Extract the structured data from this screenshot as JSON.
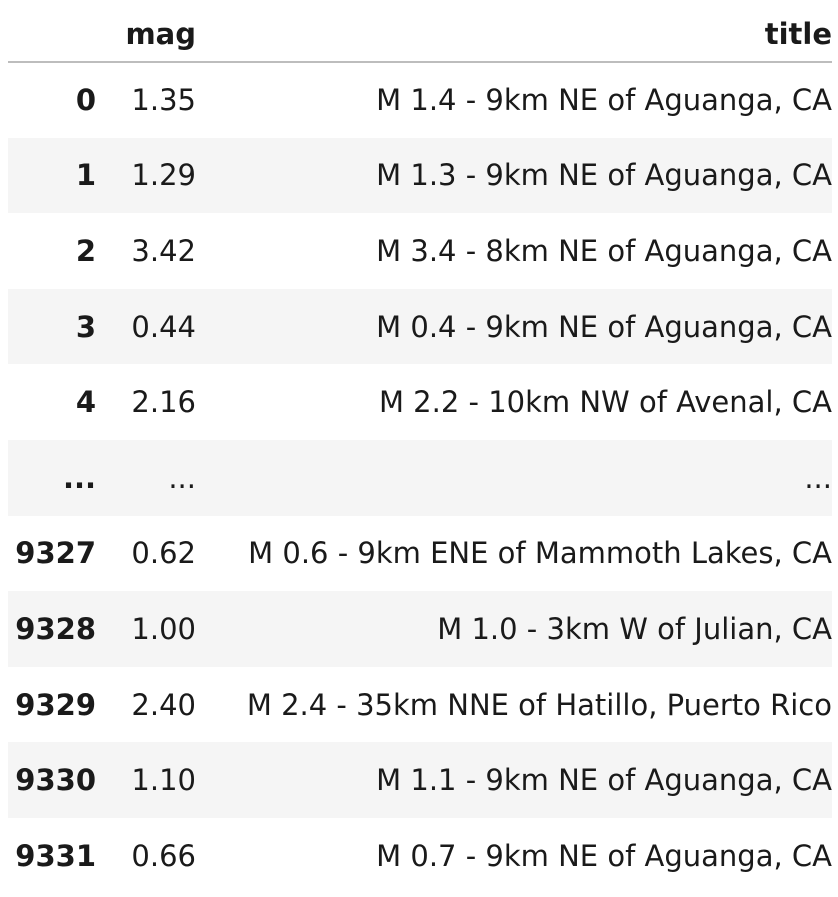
{
  "table": {
    "columns": {
      "index": "",
      "mag": "mag",
      "title": "title"
    },
    "rows": [
      {
        "index": "0",
        "mag": "1.35",
        "title": "M 1.4 - 9km NE of Aguanga, CA"
      },
      {
        "index": "1",
        "mag": "1.29",
        "title": "M 1.3 - 9km NE of Aguanga, CA"
      },
      {
        "index": "2",
        "mag": "3.42",
        "title": "M 3.4 - 8km NE of Aguanga, CA"
      },
      {
        "index": "3",
        "mag": "0.44",
        "title": "M 0.4 - 9km NE of Aguanga, CA"
      },
      {
        "index": "4",
        "mag": "2.16",
        "title": "M 2.2 - 10km NW of Avenal, CA"
      },
      {
        "index": "...",
        "mag": "...",
        "title": "..."
      },
      {
        "index": "9327",
        "mag": "0.62",
        "title": "M 0.6 - 9km ENE of Mammoth Lakes, CA"
      },
      {
        "index": "9328",
        "mag": "1.00",
        "title": "M 1.0 - 3km W of Julian, CA"
      },
      {
        "index": "9329",
        "mag": "2.40",
        "title": "M 2.4 - 35km NNE of Hatillo, Puerto Rico"
      },
      {
        "index": "9330",
        "mag": "1.10",
        "title": "M 1.1 - 9km NE of Aguanga, CA"
      },
      {
        "index": "9331",
        "mag": "0.66",
        "title": "M 0.7 - 9km NE of Aguanga, CA"
      }
    ]
  }
}
